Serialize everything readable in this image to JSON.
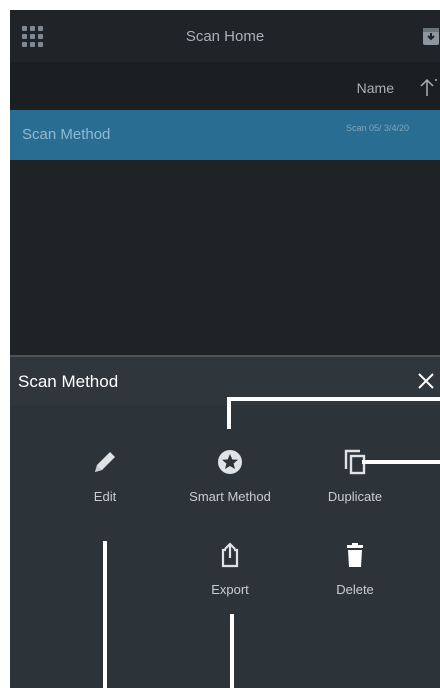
{
  "header": {
    "title": "Scan Home"
  },
  "sort": {
    "label": "Name"
  },
  "list": {
    "items": [
      {
        "name": "Scan Method",
        "date": "Scan 05/ 3/4/20"
      }
    ]
  },
  "sheet": {
    "title": "Scan Method",
    "actions": {
      "edit": "Edit",
      "smart_method": "Smart Method",
      "duplicate": "Duplicate",
      "export": "Export",
      "delete": "Delete"
    }
  },
  "colors": {
    "background": "#1f2326",
    "selected_row": "#2a6d93",
    "sheet": "#2c343a",
    "text_primary": "#ffffff",
    "text_secondary": "#a9b0b6"
  },
  "icons": [
    "apps-grid-icon",
    "archive-icon",
    "sort-ascending-icon",
    "close-icon",
    "pencil-icon",
    "star-badge-icon",
    "copy-icon",
    "share-icon",
    "trash-icon"
  ]
}
